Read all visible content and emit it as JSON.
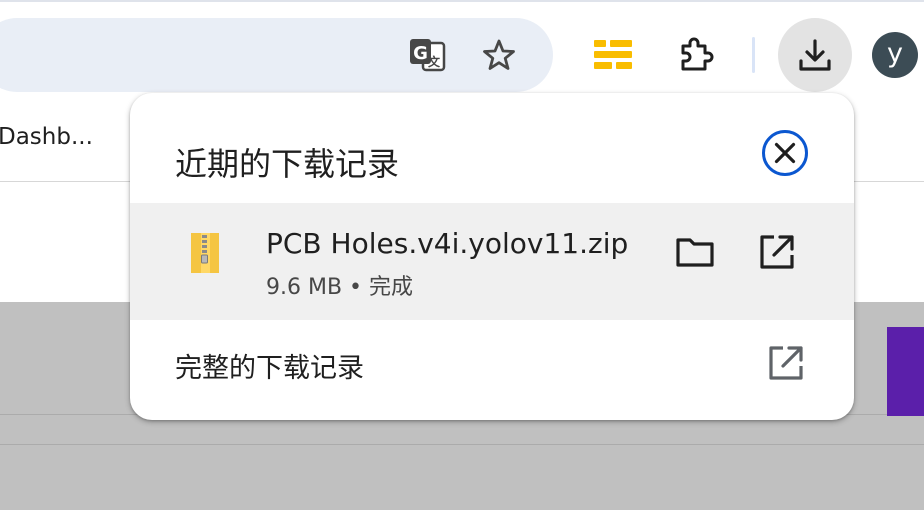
{
  "toolbar": {
    "icons": [
      "translate-icon",
      "star-icon",
      "extension-app-icon",
      "puzzle-icon",
      "download-icon"
    ],
    "avatar_initial": "y"
  },
  "bookmarks_bar": {
    "visible_text": "Dashb..."
  },
  "download_bubble": {
    "title": "近期的下载记录",
    "items": [
      {
        "file_name": "PCB Holes.v4i.yolov11.zip",
        "status": "9.6 MB • 完成",
        "icon": "zip-file-icon"
      }
    ],
    "full_history_label": "完整的下载记录"
  },
  "colors": {
    "accent": "#0b57d0",
    "omnibox_bg": "#e9eef6",
    "item_bg": "#f0f0f0",
    "avatar_bg": "#3c4c55",
    "extension_yellow": "#f9bd00"
  }
}
